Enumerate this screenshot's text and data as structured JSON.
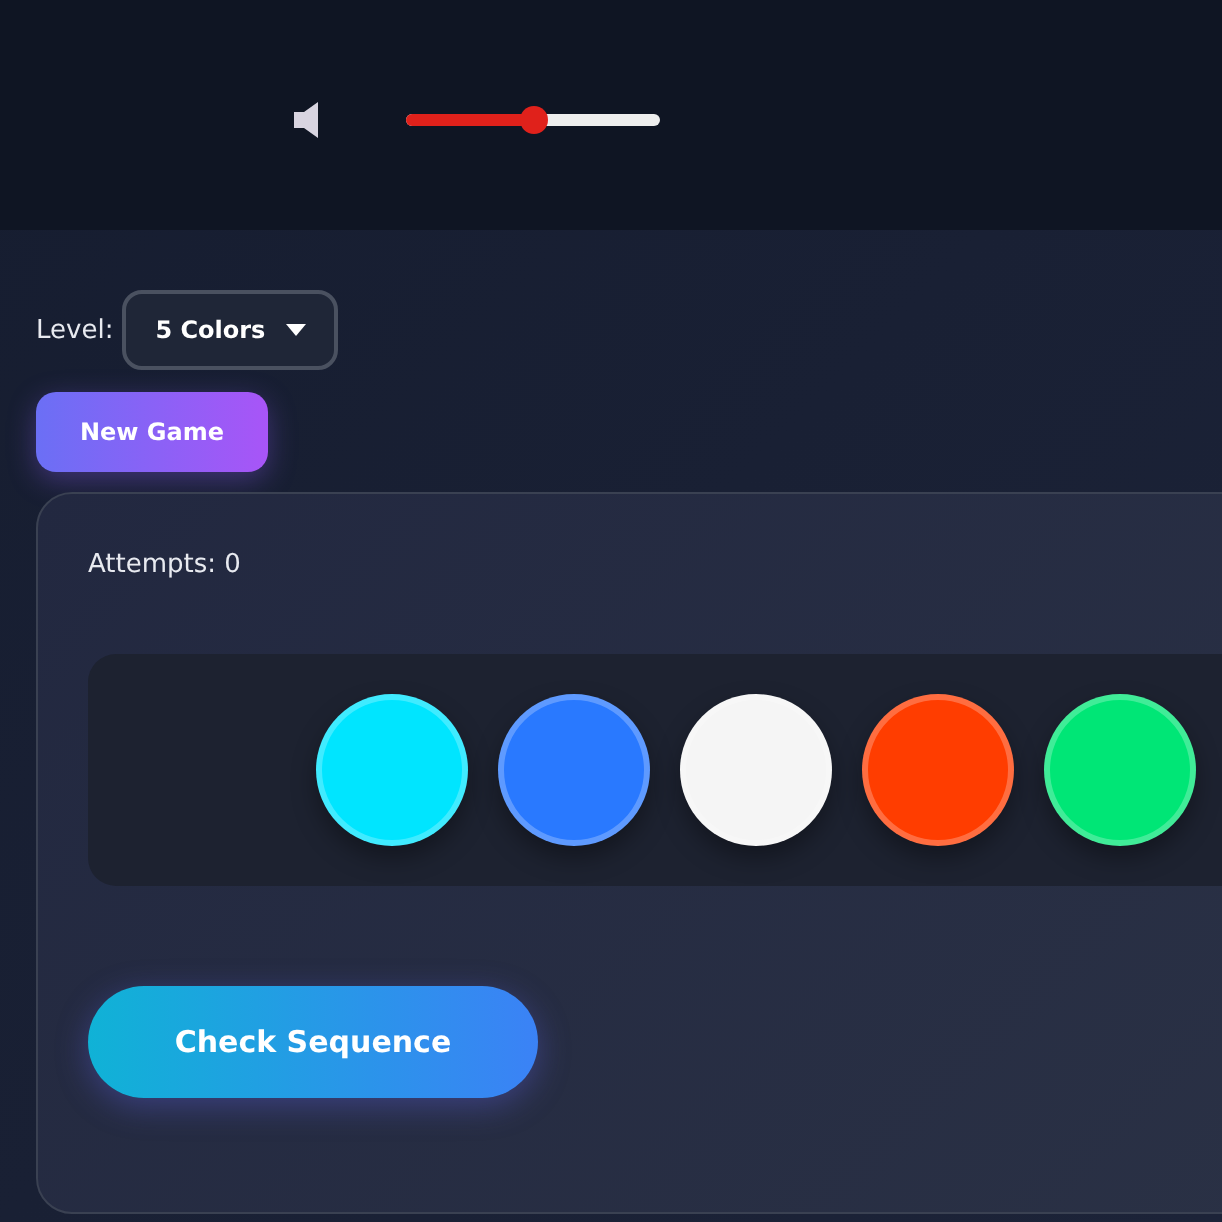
{
  "volume": {
    "level": 0.5
  },
  "level_select": {
    "label": "Level:",
    "value": "5 Colors"
  },
  "new_game_button": "New Game",
  "attempts": "Attempts: 0",
  "pegs": [
    {
      "color": "#00e5ff"
    },
    {
      "color": "#2979ff"
    },
    {
      "color": "#f5f5f5"
    },
    {
      "color": "#ff3d00"
    },
    {
      "color": "#00e676"
    }
  ],
  "check_button": "Check Sequence"
}
